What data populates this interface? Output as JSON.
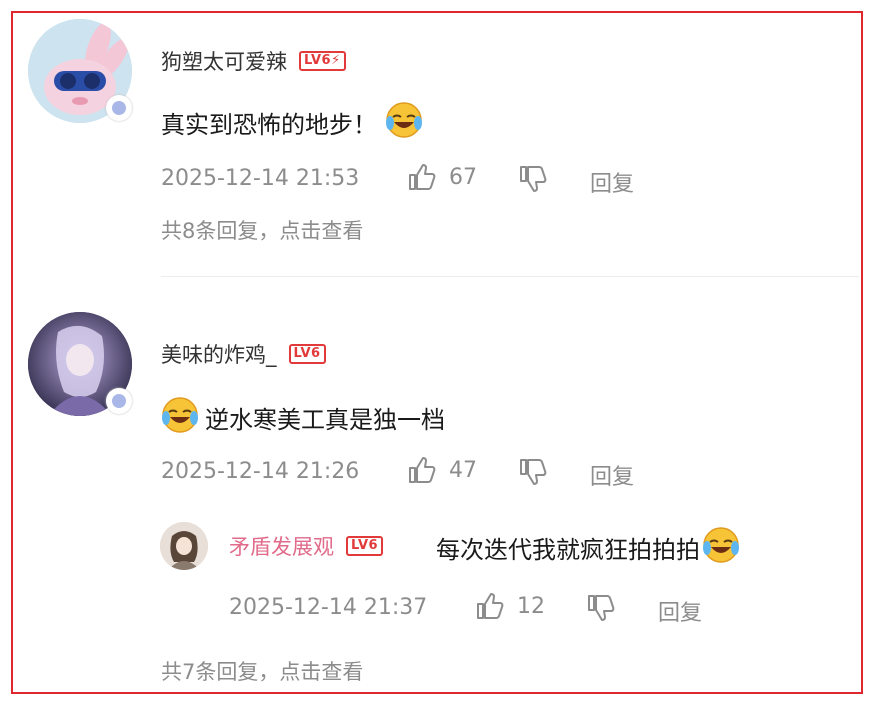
{
  "comments": [
    {
      "username": "狗塑太可爱辣",
      "level": "LV6",
      "text": "真实到恐怖的地步！",
      "time": "2025-12-14 21:53",
      "likes": "67",
      "reply_label": "回复",
      "replies_link": "共8条回复，点击查看",
      "avatar_icon": "blue-bunny-avatar",
      "emoji": "laughing-crying-emoji"
    },
    {
      "username": "美味的炸鸡_",
      "level": "LV6",
      "text": "逆水寒美工真是独一档",
      "time": "2025-12-14 21:26",
      "likes": "47",
      "reply_label": "回复",
      "replies_link": "共7条回复，点击查看",
      "avatar_icon": "anime-character-avatar",
      "emoji": "laughing-crying-emoji",
      "reply": {
        "username": "矛盾发展观",
        "level": "LV6",
        "text": "每次迭代我就疯狂拍拍拍",
        "time": "2025-12-14 21:37",
        "likes": "12",
        "reply_label": "回复",
        "emoji": "laughing-crying-emoji"
      }
    }
  ],
  "colors": {
    "border": "#e0262f",
    "level_badge": "#e23a3a",
    "reply_username": "#e06b8a",
    "meta_text": "#8c8c8c"
  }
}
